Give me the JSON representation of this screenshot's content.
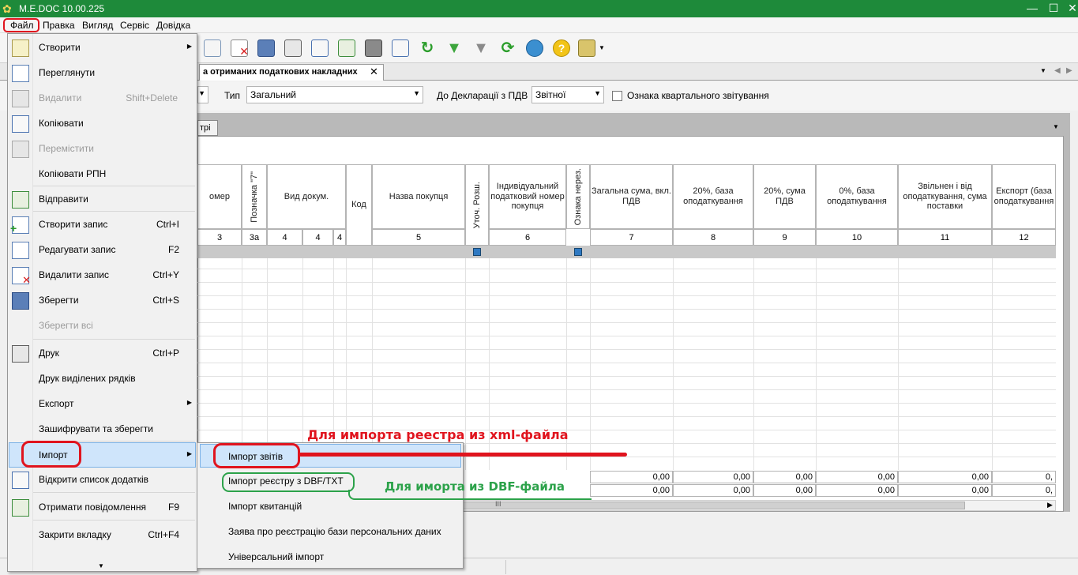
{
  "window": {
    "title": "M.E.DOC 10.00.225"
  },
  "menubar": {
    "file": "Файл",
    "edit": "Правка",
    "view": "Вигляд",
    "service": "Сервіс",
    "help": "Довідка"
  },
  "tab": {
    "title": "а отриманих податкових накладних",
    "close": "✕"
  },
  "subtab": {
    "label": "трі"
  },
  "filters": {
    "type_label": "Тип",
    "type_value": "Загальний",
    "decl_label": "До Декларації з ПДВ",
    "decl_value": "Звітної",
    "quarterly_label": "Ознака квартального звітування"
  },
  "table": {
    "headers": {
      "number": "омер",
      "mark7": "Позначка \"7\"",
      "doc_kind": "Вид докум.",
      "code": "Код",
      "buyer": "Назва покупця",
      "clar": "Уточ. Розш.",
      "ipn": "Індивідуальний податковий номер покупця",
      "nonres": "Ознака нерез.",
      "total": "Загальна сума, вкл. ПДВ",
      "base20": "20%, база оподаткування",
      "vat20": "20%, сума ПДВ",
      "base0": "0%, база оподаткування",
      "exempt": "Звільнен і від оподаткування, сума поставки",
      "export": "Експорт (база оподаткування"
    },
    "numbers": [
      "3",
      "3а",
      "4",
      "4",
      "4",
      "5",
      "6",
      "7",
      "8",
      "9",
      "10",
      "11",
      "12"
    ],
    "totals": [
      [
        "0,00",
        "0,00",
        "0,00",
        "0,00",
        "0,00",
        "0,"
      ],
      [
        "0,00",
        "0,00",
        "0,00",
        "0,00",
        "0,00",
        "0,"
      ]
    ],
    "scroll_mark": "III"
  },
  "file_menu": {
    "items": [
      {
        "label": "Створити",
        "shortcut": "",
        "submenu": true,
        "disabled": false
      },
      {
        "label": "Переглянути",
        "shortcut": "",
        "submenu": false,
        "disabled": false
      },
      {
        "label": "Видалити",
        "shortcut": "Shift+Delete",
        "submenu": false,
        "disabled": true
      },
      {
        "label": "Копіювати",
        "shortcut": "",
        "submenu": false,
        "disabled": false
      },
      {
        "label": "Перемістити",
        "shortcut": "",
        "submenu": false,
        "disabled": true
      },
      {
        "label": "Копіювати РПН",
        "shortcut": "",
        "submenu": false,
        "disabled": false
      },
      {
        "label": "Відправити",
        "shortcut": "",
        "submenu": false,
        "disabled": false
      },
      {
        "label": "Створити запис",
        "shortcut": "Ctrl+I",
        "submenu": false,
        "disabled": false
      },
      {
        "label": "Редагувати запис",
        "shortcut": "F2",
        "submenu": false,
        "disabled": false
      },
      {
        "label": "Видалити запис",
        "shortcut": "Ctrl+Y",
        "submenu": false,
        "disabled": false
      },
      {
        "label": "Зберегти",
        "shortcut": "Ctrl+S",
        "submenu": false,
        "disabled": false
      },
      {
        "label": "Зберегти всі",
        "shortcut": "",
        "submenu": false,
        "disabled": true
      },
      {
        "label": "Друк",
        "shortcut": "Ctrl+P",
        "submenu": false,
        "disabled": false
      },
      {
        "label": "Друк виділених рядків",
        "shortcut": "",
        "submenu": false,
        "disabled": false
      },
      {
        "label": "Експорт",
        "shortcut": "",
        "submenu": true,
        "disabled": false
      },
      {
        "label": "Зашифрувати та зберегти",
        "shortcut": "",
        "submenu": false,
        "disabled": false
      },
      {
        "label": "Імпорт",
        "shortcut": "",
        "submenu": true,
        "disabled": false
      },
      {
        "label": "Відкрити список додатків",
        "shortcut": "",
        "submenu": false,
        "disabled": false
      },
      {
        "label": "Отримати повідомлення",
        "shortcut": "F9",
        "submenu": false,
        "disabled": false
      },
      {
        "label": "Закрити вкладку",
        "shortcut": "Ctrl+F4",
        "submenu": false,
        "disabled": false
      }
    ]
  },
  "import_submenu": {
    "items": [
      "Імпорт звітів",
      "Імпорт реєстру з DBF/TXT",
      "Імпорт квитанцій",
      "Заява про реєстрацію бази персональних даних",
      "Універсальний імпорт"
    ]
  },
  "annotations": {
    "xml_note": "Для импорта реестра из xml-файла",
    "dbf_note": "Для иморта из DBF-файла"
  },
  "colors": {
    "title_bar": "#1e8a3a",
    "annotation_red": "#e0141e",
    "annotation_green": "#2ca24a",
    "highlight": "#cfe5fb"
  }
}
